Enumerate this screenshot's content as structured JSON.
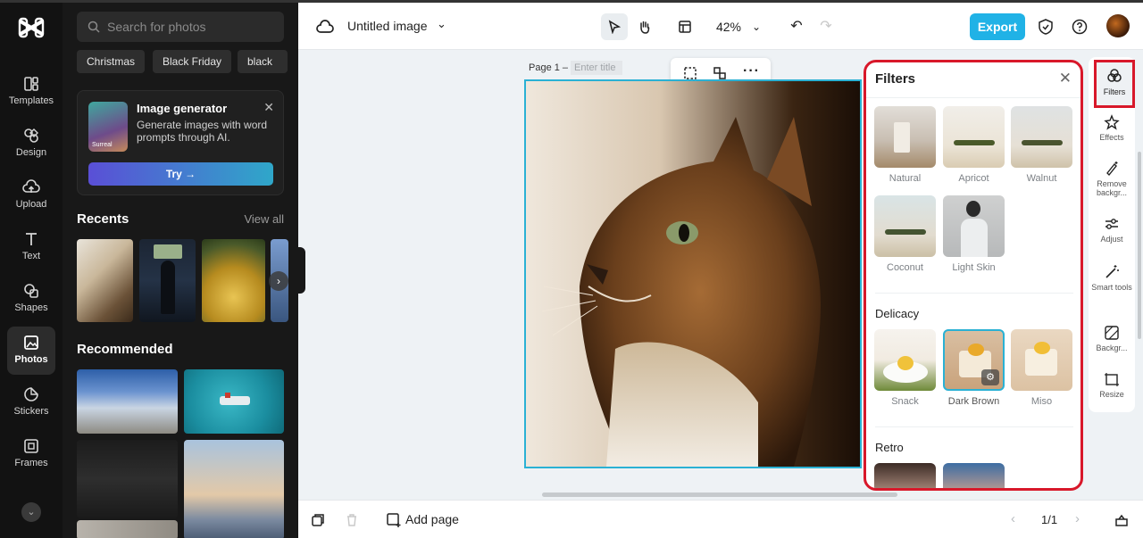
{
  "nav": {
    "items": [
      {
        "label": "Templates",
        "icon": "templates-icon"
      },
      {
        "label": "Design",
        "icon": "design-icon"
      },
      {
        "label": "Upload",
        "icon": "upload-icon"
      },
      {
        "label": "Text",
        "icon": "text-icon"
      },
      {
        "label": "Shapes",
        "icon": "shapes-icon"
      },
      {
        "label": "Photos",
        "icon": "photos-icon",
        "active": true
      },
      {
        "label": "Stickers",
        "icon": "stickers-icon"
      },
      {
        "label": "Frames",
        "icon": "frames-icon"
      }
    ]
  },
  "photos_panel": {
    "search_placeholder": "Search for photos",
    "chips": [
      "Christmas",
      "Black Friday",
      "black"
    ],
    "generator": {
      "title": "Image generator",
      "description": "Generate images with word prompts through AI.",
      "thumb_label": "Surreal",
      "try_label": "Try →"
    },
    "recents_title": "Recents",
    "view_all": "View all",
    "recommended_title": "Recommended"
  },
  "topbar": {
    "doc_title": "Untitled image",
    "zoom": "42%",
    "export_label": "Export"
  },
  "canvas": {
    "page_label": "Page 1 –",
    "title_placeholder": "Enter title"
  },
  "filters": {
    "title": "Filters",
    "presets": [
      "Natural",
      "Apricot",
      "Walnut",
      "Coconut",
      "Light Skin"
    ],
    "delicacy_title": "Delicacy",
    "delicacy": [
      "Snack",
      "Dark Brown",
      "Miso"
    ],
    "retro_title": "Retro"
  },
  "rail": {
    "items": [
      {
        "label": "Filters",
        "icon": "filters-icon"
      },
      {
        "label": "Effects",
        "icon": "effects-icon"
      },
      {
        "label": "Remove backgr...",
        "icon": "remove-background-icon"
      },
      {
        "label": "Adjust",
        "icon": "adjust-icon"
      },
      {
        "label": "Smart tools",
        "icon": "smart-tools-icon"
      },
      {
        "label": "Backgr...",
        "icon": "background-icon"
      },
      {
        "label": "Resize",
        "icon": "resize-icon"
      }
    ]
  },
  "bottombar": {
    "add_page": "Add page",
    "pager": "1/1"
  },
  "colors": {
    "accent": "#20b2e6",
    "highlight": "#d8182a",
    "selection": "#2ab1d4"
  }
}
